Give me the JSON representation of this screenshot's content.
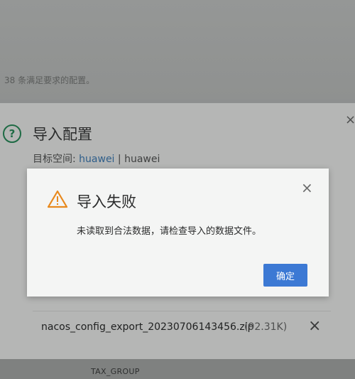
{
  "background": {
    "notice_text": "38 条满足要求的配置。",
    "column_header": "TAX_GROUP"
  },
  "import_dialog": {
    "title": "导入配置",
    "namespace_label": "目标空间:",
    "namespace_name": "huawei",
    "namespace_separator": "|",
    "namespace_id": "huawei",
    "close_icon": "×",
    "file": {
      "name": "nacos_config_export_20230706143456.zip",
      "size": "(92.31K)",
      "remove_icon": "×"
    }
  },
  "error_modal": {
    "title": "导入失败",
    "message": "未读取到合法数据，请检查导入的数据文件。",
    "confirm_label": "确定",
    "close_icon": "×",
    "warning_color": "#e8891d",
    "accent_color": "#3c79d4"
  }
}
